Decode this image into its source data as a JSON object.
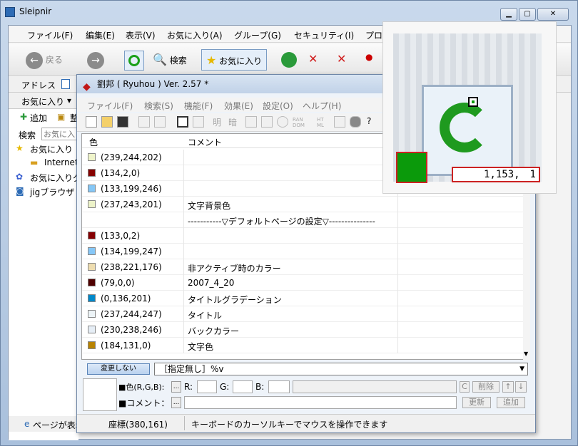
{
  "main": {
    "title": "Sleipnir",
    "menu": [
      "ファイル(F)",
      "編集(E)",
      "表示(V)",
      "お気に入り(A)",
      "グループ(G)",
      "セキュリティ(I)",
      "プロ"
    ],
    "toolbar": {
      "back": "戻る",
      "search": "検索",
      "favorites": "お気に入り"
    },
    "address_label": "アドレス",
    "sidebar": {
      "tab": "お気に入り",
      "add": "追加",
      "organize": "整",
      "search_label": "検索",
      "search_placeholder": "お気に入",
      "items": [
        "お気に入り",
        "Internet",
        "お気に入りグ",
        "jigブラウザ"
      ]
    },
    "status": "ページが表示"
  },
  "ryuhou": {
    "title": "劉邦 ( Ryuhou ) Ver. 2.57 *",
    "menu": [
      "ファイル(F)",
      "検索(S)",
      "機能(F)",
      "効果(E)",
      "設定(O)",
      "ヘルプ(H)"
    ],
    "toolbar_text": [
      "明",
      "暗",
      "RAN\nDOM",
      "HT\nML"
    ],
    "list_header": {
      "color": "色",
      "comment": "コメント"
    },
    "rows": [
      {
        "rgb": "(239,244,202)",
        "comment": "",
        "color": "#eff4ca"
      },
      {
        "rgb": "(134,2,0)",
        "comment": "",
        "color": "#860200"
      },
      {
        "rgb": "(133,199,246)",
        "comment": "",
        "color": "#85c7f6"
      },
      {
        "rgb": "(237,243,201)",
        "comment": "文字背景色",
        "color": "#edf3c9"
      },
      {
        "rgb": "",
        "comment": "-----------▽デフォルトページの設定▽---------------",
        "color": ""
      },
      {
        "rgb": "(133,0,2)",
        "comment": "",
        "color": "#850002"
      },
      {
        "rgb": "(134,199,247)",
        "comment": "",
        "color": "#86c7f7"
      },
      {
        "rgb": "(238,221,176)",
        "comment": "非アクティブ時のカラー",
        "color": "#eeddb0"
      },
      {
        "rgb": "(79,0,0)",
        "comment": "2007_4_20",
        "color": "#4f0000"
      },
      {
        "rgb": "(0,136,201)",
        "comment": "タイトルグラデーション",
        "color": "#0088c9"
      },
      {
        "rgb": "(237,244,247)",
        "comment": "タイトル",
        "color": "#edf4f7"
      },
      {
        "rgb": "(230,238,246)",
        "comment": "バックカラー",
        "color": "#e6eef6"
      },
      {
        "rgb": "(184,131,0)",
        "comment": "文字色",
        "color": "#b88300"
      }
    ],
    "no_change_button": "変更しない",
    "combo_value": "［指定無し］%v",
    "rgb_label": "■色(R,G,B):",
    "r_label": "R:",
    "g_label": "G:",
    "b_label": "B:",
    "comment_label": "■コメント：",
    "c_button": "C",
    "delete_button": "削除",
    "up_button": "↑",
    "down_button": "↓",
    "update_button": "更新",
    "add_button": "追加",
    "ellipsis": "...",
    "coords": "座標(380,161)",
    "hint": "キーボードのカーソルキーでマウスを操作できます"
  },
  "zoom": {
    "readout": "1,153,　1",
    "sample_color": "#0b9a0b"
  }
}
